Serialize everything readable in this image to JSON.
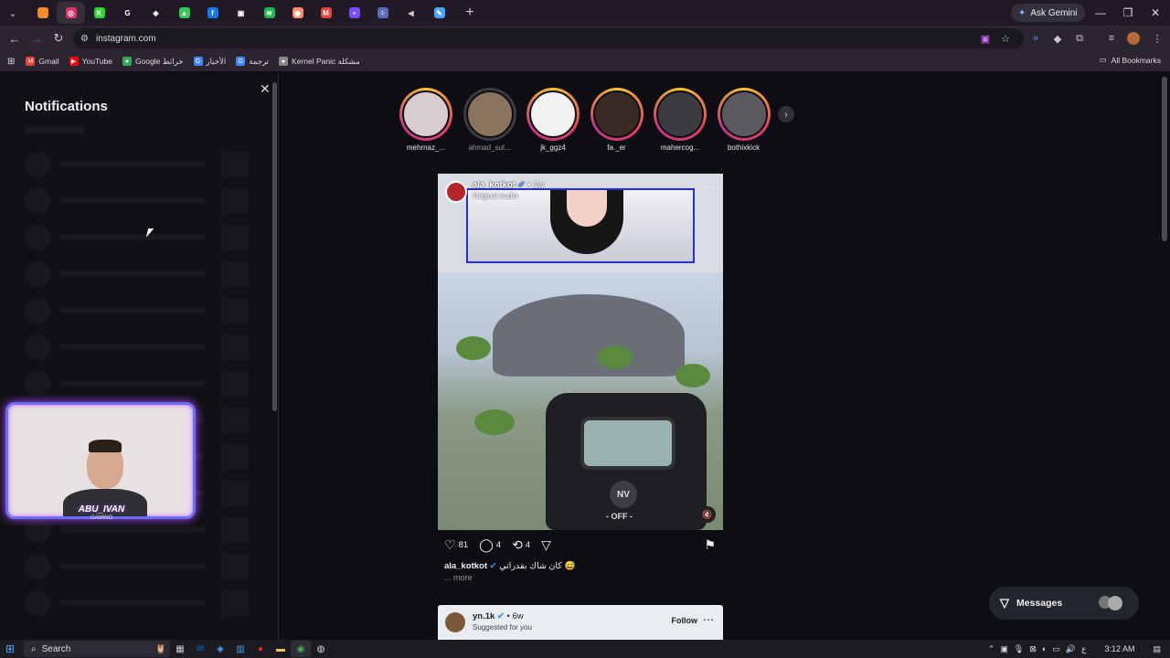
{
  "browser": {
    "tabs": [
      {
        "icon": "orange-square-icon",
        "color": "#f28c28",
        "glyph": ""
      },
      {
        "icon": "instagram-icon",
        "color": "#e1306c",
        "glyph": "◎",
        "active": true
      },
      {
        "icon": "kick-icon",
        "color": "#2bd62b",
        "glyph": "K"
      },
      {
        "icon": "google-icon",
        "color": "#ffffff",
        "glyph": "G"
      },
      {
        "icon": "extension-icon",
        "color": "#ffffff",
        "glyph": "◆"
      },
      {
        "icon": "stats-icon",
        "color": "#34c759",
        "glyph": "▲"
      },
      {
        "icon": "facebook-icon",
        "color": "#1877f2",
        "glyph": "f"
      },
      {
        "icon": "page-icon",
        "color": "#ffffff",
        "glyph": "▣"
      },
      {
        "icon": "spotify-icon",
        "color": "#1db954",
        "glyph": "≋"
      },
      {
        "icon": "shield-icon",
        "color": "#ff8a65",
        "glyph": "◉"
      },
      {
        "icon": "gmail-icon",
        "color": "#ea4335",
        "glyph": "M"
      },
      {
        "icon": "purple-app-icon",
        "color": "#7c4dff",
        "glyph": "▪"
      },
      {
        "icon": "dots-icon",
        "color": "#5c6bc0",
        "glyph": "⁘"
      },
      {
        "icon": "audio-icon",
        "color": "#cccccc",
        "glyph": "◀"
      },
      {
        "icon": "edit-icon",
        "color": "#4aa3ff",
        "glyph": "✎"
      }
    ],
    "ask_gemini": "Ask Gemini",
    "url": "instagram.com",
    "bookmarks": [
      {
        "label": "Gmail",
        "icon": "gmail-icon",
        "color": "#ea4335",
        "glyph": "M"
      },
      {
        "label": "YouTube",
        "icon": "youtube-icon",
        "color": "#ff0000",
        "glyph": "▶"
      },
      {
        "label": "Google خرائط",
        "icon": "maps-icon",
        "color": "#34a853",
        "glyph": "●"
      },
      {
        "label": "الأخبار",
        "icon": "news-icon",
        "color": "#4285f4",
        "glyph": "G"
      },
      {
        "label": "ترجمة",
        "icon": "translate-icon",
        "color": "#4285f4",
        "glyph": "G"
      },
      {
        "label": "Kernel Panic مشكلة",
        "icon": "kernel-icon",
        "color": "#888888",
        "glyph": "●"
      }
    ],
    "all_bookmarks": "All Bookmarks"
  },
  "notifications": {
    "title": "Notifications"
  },
  "webcam": {
    "name": "ABU_IVAN",
    "sub": "GAMING"
  },
  "stories": [
    {
      "name": "mehrnaz_...",
      "seen": false,
      "color": "#d6cdd0"
    },
    {
      "name": "ahmad_sul...",
      "seen": true,
      "color": "#8a7460"
    },
    {
      "name": "jk_ggz4",
      "seen": false,
      "color": "#f2f2f2"
    },
    {
      "name": "fa._er",
      "seen": false,
      "color": "#3a2a24"
    },
    {
      "name": "mahercog...",
      "seen": false,
      "color": "#3b3b40"
    },
    {
      "name": "bothixkick",
      "seen": false,
      "color": "#5a5b60"
    }
  ],
  "post": {
    "username": "ala_kotkot",
    "time": "• 1w",
    "audio": "Original audio",
    "likes": "81",
    "comments": "4",
    "reposts": "4",
    "caption_user": "ala_kotkot",
    "caption_text": "كان شاك بقدراتي 😅",
    "more": "... more",
    "scope_nv": "NV",
    "scope_off": "- OFF -"
  },
  "post2": {
    "username": "yn.1k",
    "time": "• 6w",
    "sub": "Suggested for you",
    "follow": "Follow"
  },
  "messages": {
    "label": "Messages"
  },
  "taskbar": {
    "search": "Search",
    "time": "3:12 AM",
    "lang": "ع"
  }
}
